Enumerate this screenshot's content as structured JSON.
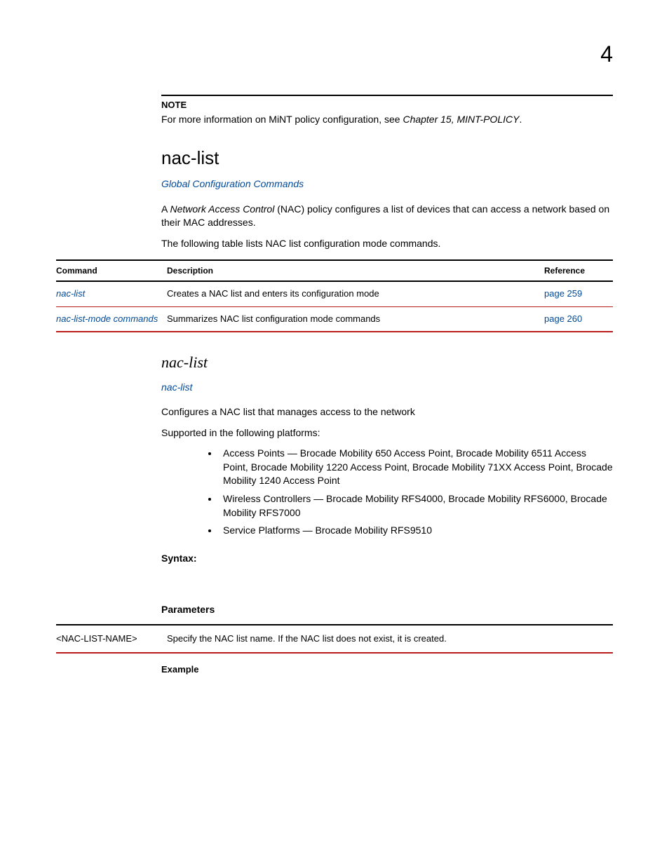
{
  "chapter_number": "4",
  "note": {
    "label": "NOTE",
    "text_prefix": "For more information on MiNT policy configuration, see ",
    "text_italic": "Chapter 15, MINT-POLICY",
    "text_suffix": "."
  },
  "section": {
    "title": "nac-list",
    "breadcrumb": "Global Configuration Commands",
    "intro_prefix": "A ",
    "intro_italic": "Network Access Control",
    "intro_suffix": " (NAC) policy configures a list of devices that can access a network based on their MAC addresses.",
    "table_intro": "The following table lists NAC list configuration mode commands."
  },
  "cmd_table": {
    "headers": {
      "command": "Command",
      "description": "Description",
      "reference": "Reference"
    },
    "rows": [
      {
        "command": "nac-list",
        "description": "Creates a NAC list and enters its configuration mode",
        "reference": "page 259"
      },
      {
        "command": "nac-list-mode commands",
        "description": "Summarizes NAC list configuration mode commands",
        "reference": "page 260"
      }
    ]
  },
  "subsection": {
    "title": "nac-list",
    "breadcrumb": "nac-list",
    "desc": "Configures a NAC list that manages access to the network",
    "supported_label": "Supported in the following platforms:",
    "platforms": [
      "Access Points — Brocade Mobility 650 Access Point, Brocade Mobility 6511 Access Point, Brocade Mobility 1220 Access Point, Brocade Mobility 71XX Access Point, Brocade Mobility 1240 Access Point",
      "Wireless Controllers — Brocade Mobility RFS4000, Brocade Mobility RFS6000, Brocade Mobility RFS7000",
      "Service Platforms — Brocade Mobility RFS9510"
    ],
    "syntax_label": "Syntax:",
    "parameters_label": "Parameters",
    "param_table": {
      "rows": [
        {
          "name": "<NAC-LIST-NAME>",
          "desc": "Specify the NAC list name. If the NAC list does not exist, it is created."
        }
      ]
    },
    "example_label": "Example"
  }
}
